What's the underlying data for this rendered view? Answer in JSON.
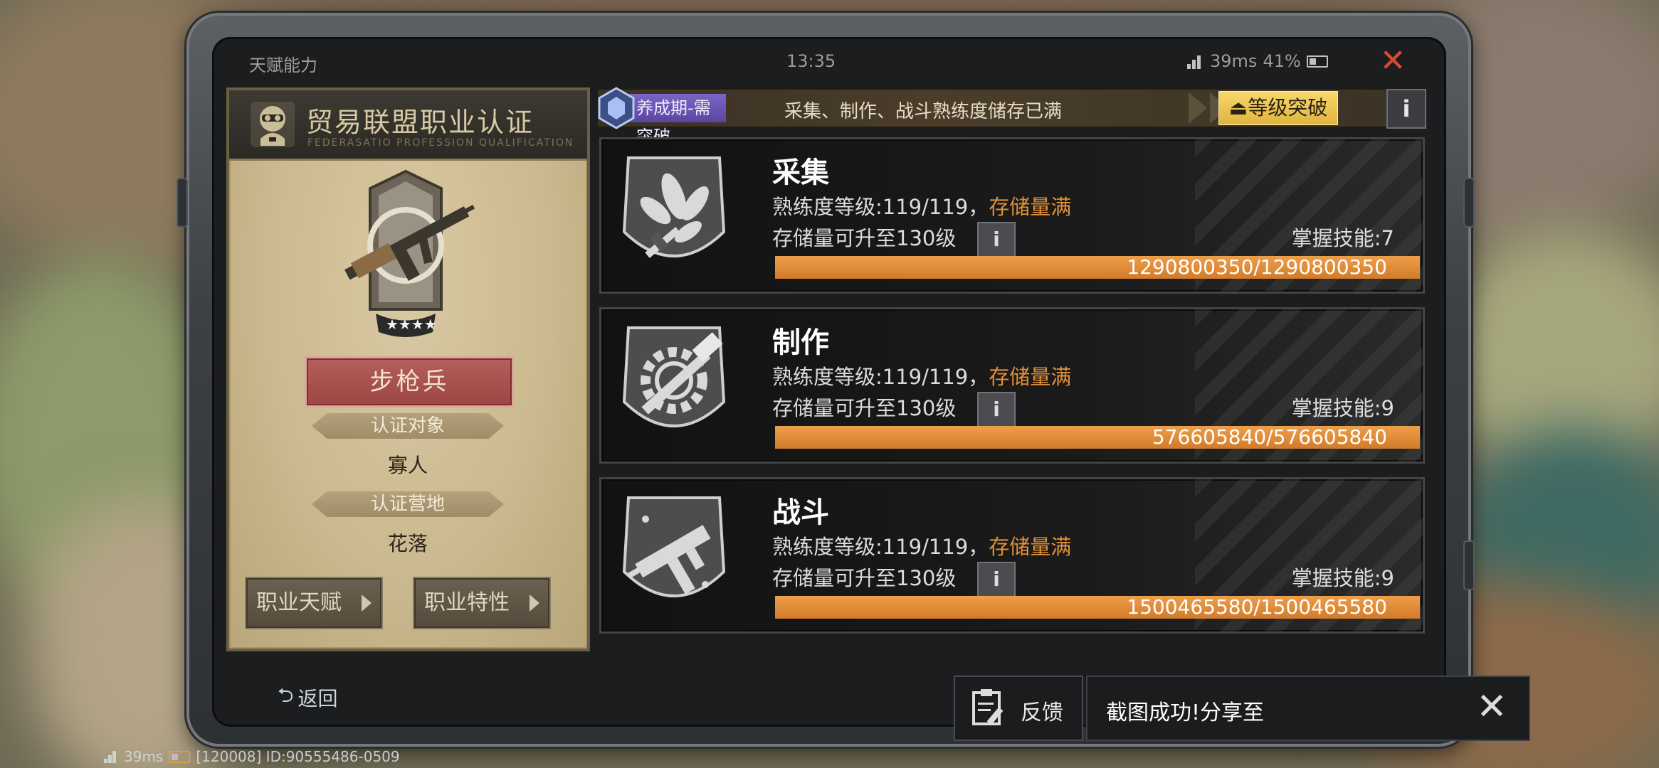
{
  "status_bar": {
    "title": "天赋能力",
    "time": "13:35",
    "ping": "39ms",
    "battery": "41%"
  },
  "card": {
    "title": "贸易联盟职业认证",
    "subtitle": "FEDERASATIO PROFESSION QUALIFICATION",
    "class_name": "步枪兵",
    "stars": 4,
    "target_label": "认证对象",
    "target_value": "寡人",
    "camp_label": "认证营地",
    "camp_value": "花落",
    "talent_button": "职业天赋",
    "trait_button": "职业特性"
  },
  "banner": {
    "stage": "养成期-需突破",
    "message": "采集、制作、战斗熟练度储存已满",
    "breakthrough_button": "等级突破",
    "info_button": "i"
  },
  "skills": [
    {
      "name": "采集",
      "level_prefix": "熟练度等级:119/119，",
      "level_status": "存储量满",
      "capacity": "存储量可升至130级",
      "mastery": "掌握技能:7",
      "progress": "1290800350/1290800350",
      "progress_fraction": 1.0,
      "icon": "leaf-icon"
    },
    {
      "name": "制作",
      "level_prefix": "熟练度等级:119/119，",
      "level_status": "存储量满",
      "capacity": "存储量可升至130级",
      "mastery": "掌握技能:9",
      "progress": "576605840/576605840",
      "progress_fraction": 1.0,
      "icon": "hammer-gear-icon"
    },
    {
      "name": "战斗",
      "level_prefix": "熟练度等级:119/119，",
      "level_status": "存储量满",
      "capacity": "存储量可升至130级",
      "mastery": "掌握技能:9",
      "progress": "1500465580/1500465580",
      "progress_fraction": 1.0,
      "icon": "smg-icon"
    }
  ],
  "bottom": {
    "back": "返回",
    "feedback": "反馈",
    "toast": "截图成功!分享至"
  },
  "footer": {
    "ping": "39ms",
    "id_text": "[120008] ID:90555486-0509"
  },
  "colors": {
    "accent_orange": "#e08d39",
    "close_red": "#d84a33",
    "class_red": "#a4504d",
    "stage_purple": "#6a55b2",
    "breakthrough_gold": "#f0c656"
  }
}
